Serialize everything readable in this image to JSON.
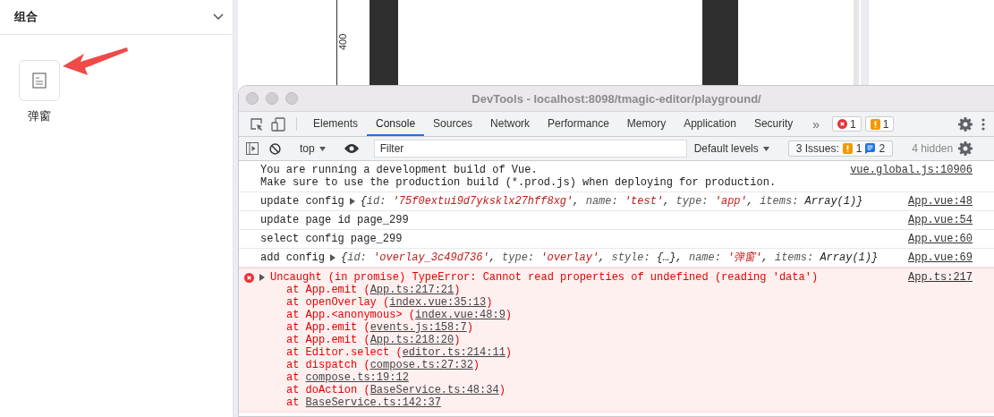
{
  "panel": {
    "title": "组合",
    "expanded": true,
    "items": [
      {
        "label": "弹窗"
      }
    ]
  },
  "ruler": {
    "label": "400"
  },
  "devtools": {
    "title": "DevTools - localhost:8098/tmagic-editor/playground/",
    "tabs": [
      {
        "label": "Elements",
        "selected": false
      },
      {
        "label": "Console",
        "selected": true
      },
      {
        "label": "Sources",
        "selected": false
      },
      {
        "label": "Network",
        "selected": false
      },
      {
        "label": "Performance",
        "selected": false
      },
      {
        "label": "Memory",
        "selected": false
      },
      {
        "label": "Application",
        "selected": false
      },
      {
        "label": "Security",
        "selected": false
      }
    ],
    "more_tabs": "»",
    "error_count": "1",
    "warning_count": "1",
    "toolbar": {
      "context": "top",
      "filter_placeholder": "Filter",
      "levels": "Default levels",
      "issues_label": "3 Issues:",
      "issues_warnings": "1",
      "issues_info": "2",
      "hidden": "4 hidden"
    },
    "messages": [
      {
        "text": "You are running a development build of Vue.\nMake sure to use the production build (*.prod.js) when deploying for production.",
        "source": "vue.global.js:10906"
      },
      {
        "text": "update config",
        "object": [
          {
            "kind": "plain",
            "text": "{"
          },
          {
            "kind": "key",
            "text": "id: "
          },
          {
            "kind": "string",
            "text": "'75f0extui9d7yksklx27hff8xg'"
          },
          {
            "kind": "plain",
            "text": ", "
          },
          {
            "kind": "key",
            "text": "name: "
          },
          {
            "kind": "string",
            "text": "'test'"
          },
          {
            "kind": "plain",
            "text": ", "
          },
          {
            "kind": "key",
            "text": "type: "
          },
          {
            "kind": "string",
            "text": "'app'"
          },
          {
            "kind": "plain",
            "text": ", "
          },
          {
            "kind": "key",
            "text": "items: "
          },
          {
            "kind": "plain",
            "text": "Array(1)}"
          }
        ],
        "source": "App.vue:48"
      },
      {
        "text": "update page id page_299",
        "source": "App.vue:54"
      },
      {
        "text": "select config page_299",
        "source": "App.vue:60"
      },
      {
        "text": "add config",
        "object": [
          {
            "kind": "plain",
            "text": "{"
          },
          {
            "kind": "key",
            "text": "id: "
          },
          {
            "kind": "string",
            "text": "'overlay_3c49d736'"
          },
          {
            "kind": "plain",
            "text": ", "
          },
          {
            "kind": "key",
            "text": "type: "
          },
          {
            "kind": "string",
            "text": "'overlay'"
          },
          {
            "kind": "plain",
            "text": ", "
          },
          {
            "kind": "key",
            "text": "style: "
          },
          {
            "kind": "plain",
            "text": "{…}"
          },
          {
            "kind": "plain",
            "text": ", "
          },
          {
            "kind": "key",
            "text": "name: "
          },
          {
            "kind": "string",
            "text": "'弹窗'"
          },
          {
            "kind": "plain",
            "text": ", "
          },
          {
            "kind": "key",
            "text": "items: "
          },
          {
            "kind": "plain",
            "text": "Array(1)}"
          }
        ],
        "source": "App.vue:69"
      }
    ],
    "error": {
      "text": "Uncaught (in promise) TypeError: Cannot read properties of undefined (reading 'data')",
      "source": "App.ts:217",
      "stack": [
        {
          "before": "at App.emit (",
          "link": "App.ts:217:21",
          "after": ")"
        },
        {
          "before": "at openOverlay (",
          "link": "index.vue:35:13",
          "after": ")"
        },
        {
          "before": "at App.<anonymous> (",
          "link": "index.vue:48:9",
          "after": ")"
        },
        {
          "before": "at App.emit (",
          "link": "events.js:158:7",
          "after": ")"
        },
        {
          "before": "at App.emit (",
          "link": "App.ts:218:20",
          "after": ")"
        },
        {
          "before": "at Editor.select (",
          "link": "editor.ts:214:11",
          "after": ")"
        },
        {
          "before": "at dispatch (",
          "link": "compose.ts:27:32",
          "after": ")"
        },
        {
          "before": "at ",
          "link": "compose.ts:19:12"
        },
        {
          "before": "at doAction (",
          "link": "BaseService.ts:48:34",
          "after": ")"
        },
        {
          "before": "at ",
          "link": "BaseService.ts:142:37"
        }
      ]
    }
  }
}
